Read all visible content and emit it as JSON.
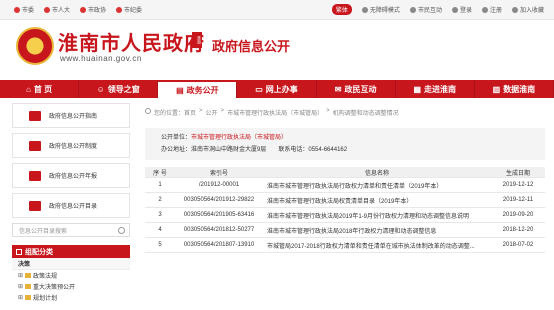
{
  "topbar": {
    "left": [
      "市委",
      "市人大",
      "市政协",
      "市纪委"
    ],
    "lang": "繁体",
    "right": [
      "无障碍模式",
      "市民互动",
      "登录",
      "注册",
      "加入收藏"
    ]
  },
  "header": {
    "gov_name": "淮南市人民政府",
    "url": "www.huainan.gov.cn",
    "seal": "淮南",
    "site_title": "政府信息公开"
  },
  "nav": [
    {
      "label": "首 页",
      "icon": "home-icon"
    },
    {
      "label": "领导之窗",
      "icon": "people-icon"
    },
    {
      "label": "政务公开",
      "icon": "doc-icon"
    },
    {
      "label": "网上办事",
      "icon": "monitor-icon"
    },
    {
      "label": "政民互动",
      "icon": "chat-icon"
    },
    {
      "label": "走进淮南",
      "icon": "building-icon"
    },
    {
      "label": "数据淮南",
      "icon": "chart-icon"
    }
  ],
  "side": {
    "buttons": [
      "政府信息公开指南",
      "政府信息公开制度",
      "政府信息公开年报",
      "政府信息公开目录"
    ],
    "search_placeholder": "信息公开目录搜索",
    "category_title": "组配分类",
    "category_root": "决策",
    "subs": [
      "政策法规",
      "重大决策预公开",
      "规划计划"
    ]
  },
  "breadcrumb": [
    "您的位置：首页",
    "公开",
    "市城市管理行政执法局（市城管局）",
    "机构调整和动态调整情况"
  ],
  "info": {
    "unit_label": "公开单位：",
    "unit": "市城市管理行政执法局（市城管局）",
    "address_label": "办公地址：",
    "address": "淮南市洞山中路财金大厦9层",
    "phone_label": "联系电话：",
    "phone": "0554-6644162"
  },
  "table": {
    "headers": [
      "序 号",
      "索引号",
      "信息名称",
      "生成日期"
    ],
    "rows": [
      {
        "no": "1",
        "index": "/201912-00001",
        "title": "淮南市城市管理行政执法局行政权力清单和责任清单（2019年本）",
        "date": "2019-12-12"
      },
      {
        "no": "2",
        "index": "003050564/201912-29822",
        "title": "淮南市城市管理行政执法局权责清单目录（2019年本）",
        "date": "2019-12-11"
      },
      {
        "no": "3",
        "index": "003050564/201905-63416",
        "title": "淮南市城市管理行政执法局2019年1-9月份行政权力清理和动态调整信息说明",
        "date": "2019-09-20"
      },
      {
        "no": "4",
        "index": "003050564/201812-50277",
        "title": "淮南市城市管理行政执法局2018年行政权力清理和动态调整信息",
        "date": "2018-12-20"
      },
      {
        "no": "5",
        "index": "003050564/201807-13910",
        "title": "市城管局2017-2018行政权力清单和责任清单在城市执法体制改革的动态调整...",
        "date": "2018-07-02"
      }
    ]
  }
}
